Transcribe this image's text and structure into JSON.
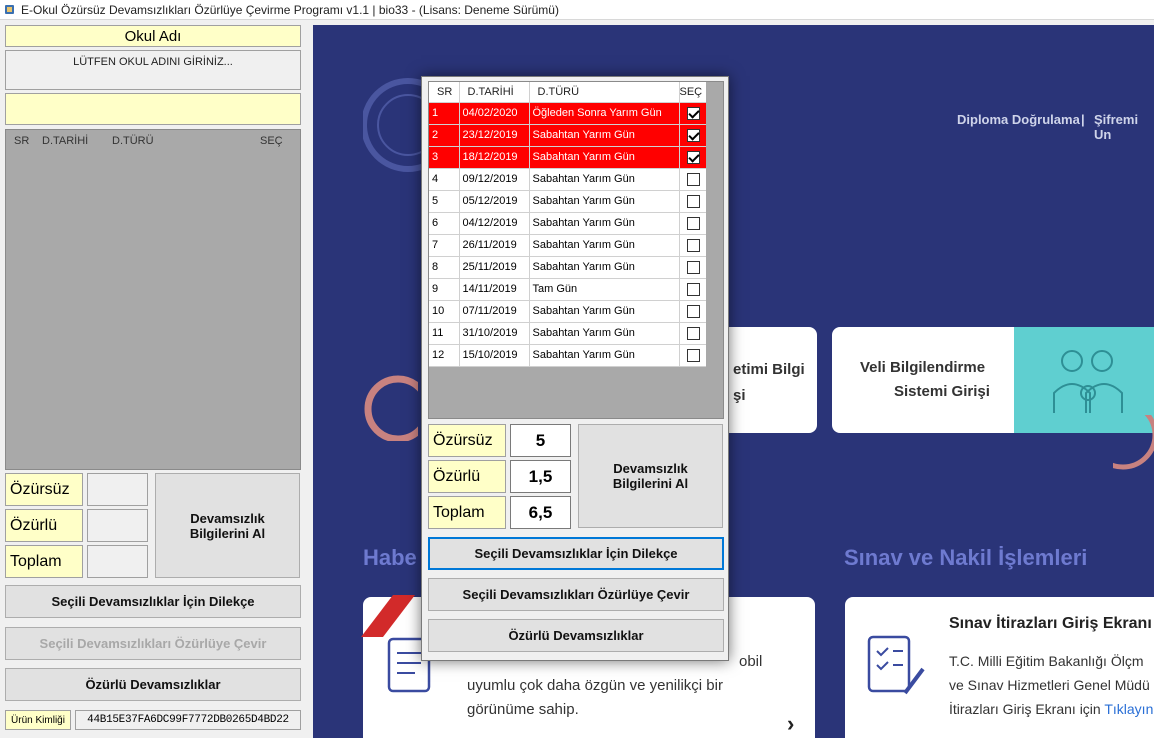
{
  "window": {
    "title": "E-Okul Özürsüz Devamsızlıkları Özürlüye Çevirme Programı v1.1 | bio33 - (Lisans: Deneme Sürümü)"
  },
  "left": {
    "school_label": "Okul Adı",
    "school_input_text": "LÜTFEN OKUL ADINI GİRİNİZ...",
    "grid_headers": {
      "sr": "SR",
      "dtarihi": "D.TARİHİ",
      "dturu": "D.TÜRÜ",
      "sec": "SEÇ"
    },
    "summary": {
      "ozursuz": "Özürsüz",
      "ozurlu": "Özürlü",
      "toplam": "Toplam"
    },
    "get_info_button": "Devamsızlık Bilgilerini Al",
    "petition_button": "Seçili Devamsızlıklar İçin Dilekçe",
    "convert_button": "Seçili Devamsızlıkları Özürlüye Çevir",
    "excused_button": "Özürlü Devamsızlıklar",
    "product_id_label": "Ürün Kimliği",
    "product_id_value": "44B15E37FA6DC99F7772DB0265D4BD22"
  },
  "browser": {
    "nav_diploma": "Diploma Doğrulama",
    "nav_separator": "|",
    "nav_password": "Şifremi Un",
    "card_info_system_line1": "etimi Bilgi",
    "card_info_system_line2": "şi",
    "card_parent_line1": "Veli Bilgilendirme",
    "card_parent_line2": "Sistemi Girişi",
    "section_news": "Habe",
    "section_exam": "Sınav ve Nakil İşlemleri",
    "news_text_line1": "obil",
    "news_text_line2": "uyumlu çok daha özgün ve yenilikçi bir",
    "news_text_line3": "görünüme sahip.",
    "exam_card_title": "Sınav İtirazları Giriş Ekranı",
    "exam_card_line1": "T.C. Milli Eğitim Bakanlığı Ölçm",
    "exam_card_line2": "ve Sınav Hizmetleri Genel Müdü",
    "exam_card_line3_prefix": "İtirazları Giriş Ekranı için",
    "exam_card_link": "Tıklayın",
    "colors": {
      "background": "#2a3478",
      "accent": "#6e7ad0",
      "teal": "#5fcfd0"
    }
  },
  "dialog": {
    "headers": {
      "sr": "SR",
      "dtarihi": "D.TARİHİ",
      "dturu": "D.TÜRÜ",
      "sec": "SEÇ"
    },
    "rows": [
      {
        "sr": "1",
        "date": "04/02/2020",
        "type": "Öğleden Sonra Yarım Gün",
        "selected": true
      },
      {
        "sr": "2",
        "date": "23/12/2019",
        "type": "Sabahtan Yarım Gün",
        "selected": true
      },
      {
        "sr": "3",
        "date": "18/12/2019",
        "type": "Sabahtan Yarım Gün",
        "selected": true
      },
      {
        "sr": "4",
        "date": "09/12/2019",
        "type": "Sabahtan Yarım Gün",
        "selected": false
      },
      {
        "sr": "5",
        "date": "05/12/2019",
        "type": "Sabahtan Yarım Gün",
        "selected": false
      },
      {
        "sr": "6",
        "date": "04/12/2019",
        "type": "Sabahtan Yarım Gün",
        "selected": false
      },
      {
        "sr": "7",
        "date": "26/11/2019",
        "type": "Sabahtan Yarım Gün",
        "selected": false
      },
      {
        "sr": "8",
        "date": "25/11/2019",
        "type": "Sabahtan Yarım Gün",
        "selected": false
      },
      {
        "sr": "9",
        "date": "14/11/2019",
        "type": "Tam Gün",
        "selected": false
      },
      {
        "sr": "10",
        "date": "07/11/2019",
        "type": "Sabahtan Yarım Gün",
        "selected": false
      },
      {
        "sr": "11",
        "date": "31/10/2019",
        "type": "Sabahtan Yarım Gün",
        "selected": false
      },
      {
        "sr": "12",
        "date": "15/10/2019",
        "type": "Sabahtan Yarım Gün",
        "selected": false
      }
    ],
    "summary": {
      "ozursuz_label": "Özürsüz",
      "ozursuz_value": "5",
      "ozurlu_label": "Özürlü",
      "ozurlu_value": "1,5",
      "toplam_label": "Toplam",
      "toplam_value": "6,5"
    },
    "get_info_button": "Devamsızlık Bilgilerini Al",
    "petition_button": "Seçili Devamsızlıklar İçin Dilekçe",
    "convert_button": "Seçili Devamsızlıkları Özürlüye Çevir",
    "excused_button": "Özürlü Devamsızlıklar",
    "colors": {
      "selected_row": "#ff0000",
      "summary_label": "#ffffc8"
    }
  }
}
